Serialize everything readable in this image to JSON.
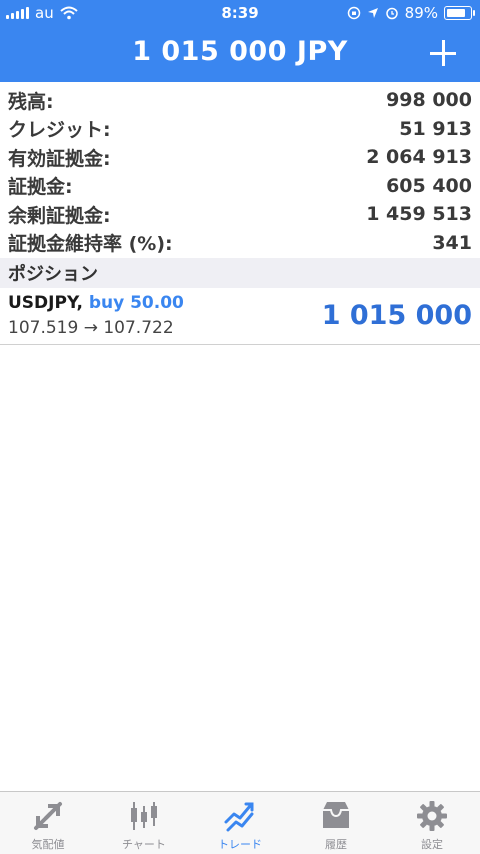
{
  "status_bar": {
    "carrier": "au",
    "time": "8:39",
    "battery": "89%",
    "battery_level": 0.89
  },
  "header": {
    "title": "1 015 000 JPY",
    "add_icon": "plus-icon"
  },
  "account": [
    {
      "label": "残高:",
      "value": "998 000"
    },
    {
      "label": "クレジット:",
      "value": "51 913"
    },
    {
      "label": "有効証拠金:",
      "value": "2 064 913"
    },
    {
      "label": "証拠金:",
      "value": "605 400"
    },
    {
      "label": "余剰証拠金:",
      "value": "1 459 513"
    },
    {
      "label": "証拠金維持率 (%):",
      "value": "341"
    }
  ],
  "positions_section": {
    "title": "ポジション"
  },
  "positions": [
    {
      "symbol": "USDJPY,",
      "direction": "buy 50.00",
      "prices": "107.519 → 107.722",
      "profit": "1 015 000"
    }
  ],
  "tabbar": {
    "active_index": 2,
    "accent": "#3a86f0",
    "items": [
      {
        "label": "気配値",
        "icon": "quotes-icon"
      },
      {
        "label": "チャート",
        "icon": "chart-icon"
      },
      {
        "label": "トレード",
        "icon": "trade-icon"
      },
      {
        "label": "履歴",
        "icon": "history-icon"
      },
      {
        "label": "設定",
        "icon": "settings-icon"
      }
    ]
  }
}
